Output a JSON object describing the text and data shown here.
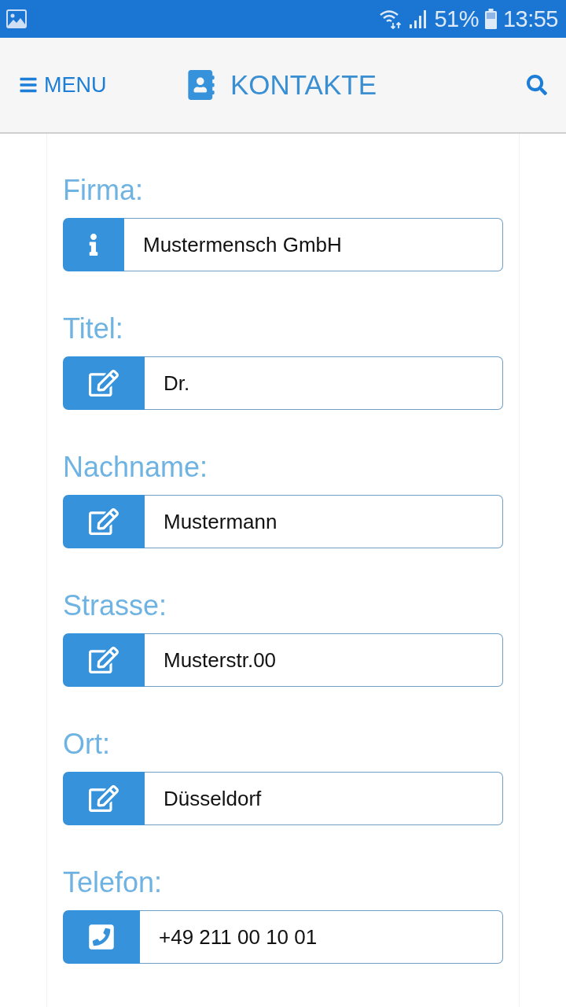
{
  "status_bar": {
    "battery": "51%",
    "time": "13:55"
  },
  "header": {
    "menu_label": "MENU",
    "title": "KONTAKTE"
  },
  "fields": [
    {
      "label": "Firma:",
      "kind": "info",
      "value": "Mustermensch GmbH"
    },
    {
      "label": "Titel:",
      "kind": "edit",
      "value": "Dr."
    },
    {
      "label": "Nachname:",
      "kind": "edit",
      "value": "Mustermann"
    },
    {
      "label": "Strasse:",
      "kind": "edit",
      "value": "Musterstr.00"
    },
    {
      "label": "Ort:",
      "kind": "edit",
      "value": "Düsseldorf"
    },
    {
      "label": "Telefon:",
      "kind": "phone",
      "value": "+49 211 00 10 01"
    }
  ]
}
